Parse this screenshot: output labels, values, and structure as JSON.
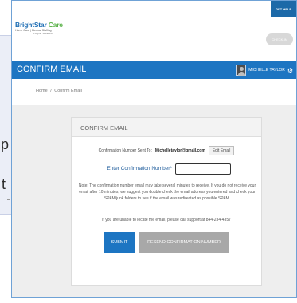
{
  "background": {
    "letter_1": "p",
    "letter_2": "t"
  },
  "topbar": {
    "get_help": "GET HELP",
    "check_in": "CHECK-IN"
  },
  "logo": {
    "name_part1": "BrightStar",
    "name_part2": " Care",
    "tagline": "Home Care | Medical Staffing",
    "tagline2": "A Higher Standard"
  },
  "header": {
    "title": "CONFIRM EMAIL",
    "user_name": "MICHELLE TAYLOR",
    "menu_glyph": "⚙"
  },
  "breadcrumb": {
    "home": "Home",
    "separator": "/",
    "current": "Confirm Email"
  },
  "card": {
    "title": "CONFIRM EMAIL",
    "sent_to_label": "Confirmation Number Sent To:",
    "email": "Michelletaylor@gmail.com",
    "edit_email": "Edit Email",
    "code_label": "Enter Confirmation Number*",
    "code_value": "",
    "note": "Note: The confirmation number email may take several minutes to receive. If you do not receive your email after 10 minutes, we suggest you double check the email address you entered and check your SPAM/junk folders to see if the email was redirected as possible SPAM.",
    "support": "If you are unable to locate the email, please call support at 844-234-4357",
    "submit": "SUBMIT",
    "resend": "RESEND CONFIRMATION NUMBER"
  },
  "colors": {
    "primary_blue": "#1d75c2",
    "brand_green": "#5bb24a",
    "disabled_gray": "#a8a8a8"
  }
}
